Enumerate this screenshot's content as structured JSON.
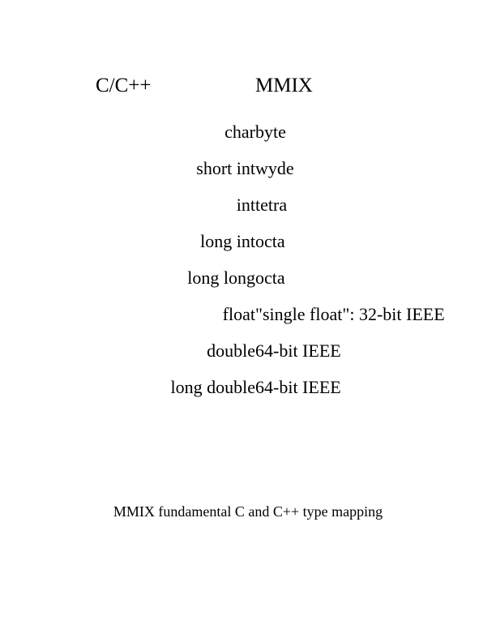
{
  "document": {
    "background_color": "#ffffff",
    "text_color": "#000000"
  },
  "table": {
    "headers": {
      "c": "C/C++",
      "mmix": "MMIX"
    },
    "rows": [
      {
        "c": "char",
        "mmix": "byte"
      },
      {
        "c": "short int",
        "mmix": "wyde"
      },
      {
        "c": "int",
        "mmix": "tetra"
      },
      {
        "c": "long int",
        "mmix": "octa"
      },
      {
        "c": "long long",
        "mmix": "octa"
      },
      {
        "c": "float",
        "mmix": "\"single float\": 32-bit IEEE"
      },
      {
        "c": "double",
        "mmix": "64-bit IEEE"
      },
      {
        "c": "long double",
        "mmix": "64-bit IEEE"
      }
    ]
  },
  "caption": "MMIX fundamental C and C++ type mapping"
}
